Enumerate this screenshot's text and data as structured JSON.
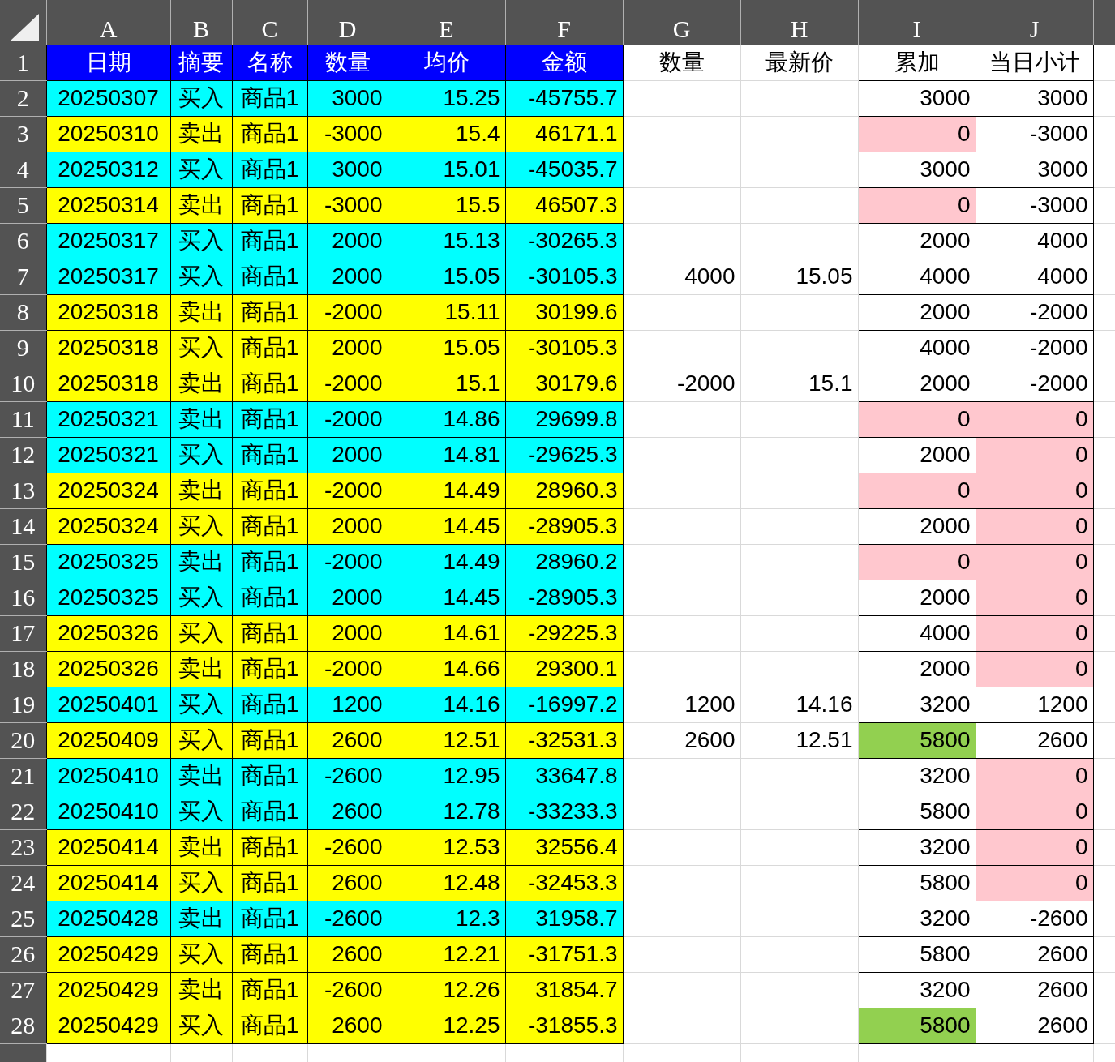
{
  "columns": [
    "A",
    "B",
    "C",
    "D",
    "E",
    "F",
    "G",
    "H",
    "I",
    "J"
  ],
  "header_row": {
    "row": "1",
    "cells": [
      {
        "text": "日期",
        "color": "#0000ff"
      },
      {
        "text": "摘要",
        "color": "#0000ff"
      },
      {
        "text": "名称",
        "color": "#0000ff"
      },
      {
        "text": "数量",
        "color": "#0000ff"
      },
      {
        "text": "均价",
        "color": "#0000ff"
      },
      {
        "text": "金额",
        "color": "#0000ff"
      },
      {
        "text": "数量"
      },
      {
        "text": "最新价"
      },
      {
        "text": "累加"
      },
      {
        "text": "当日小计"
      }
    ]
  },
  "rows": [
    {
      "row": "2",
      "color": "#00ffff",
      "cells": [
        "20250307",
        "买入",
        "商品1",
        "3000",
        "15.25",
        "-45755.7"
      ],
      "cumulative": {
        "text": "3000"
      },
      "daily_subtotal": {
        "text": "3000"
      }
    },
    {
      "row": "3",
      "color": "#ffff00",
      "cells": [
        "20250310",
        "卖出",
        "商品1",
        "-3000",
        "15.4",
        "46171.1"
      ],
      "cumulative": {
        "text": "0",
        "color": "#ffc7ce"
      },
      "daily_subtotal": {
        "text": "-3000"
      }
    },
    {
      "row": "4",
      "color": "#00ffff",
      "cells": [
        "20250312",
        "买入",
        "商品1",
        "3000",
        "15.01",
        "-45035.7"
      ],
      "cumulative": {
        "text": "3000"
      },
      "daily_subtotal": {
        "text": "3000"
      }
    },
    {
      "row": "5",
      "color": "#ffff00",
      "cells": [
        "20250314",
        "卖出",
        "商品1",
        "-3000",
        "15.5",
        "46507.3"
      ],
      "cumulative": {
        "text": "0",
        "color": "#ffc7ce"
      },
      "daily_subtotal": {
        "text": "-3000"
      }
    },
    {
      "row": "6",
      "color": "#00ffff",
      "cells": [
        "20250317",
        "买入",
        "商品1",
        "2000",
        "15.13",
        "-30265.3"
      ],
      "cumulative": {
        "text": "2000"
      },
      "daily_subtotal": {
        "text": "4000"
      }
    },
    {
      "row": "7",
      "color": "#00ffff",
      "cells": [
        "20250317",
        "买入",
        "商品1",
        "2000",
        "15.05",
        "-30105.3"
      ],
      "latest_qty": "4000",
      "latest_price": "15.05",
      "cumulative": {
        "text": "4000"
      },
      "daily_subtotal": {
        "text": "4000"
      }
    },
    {
      "row": "8",
      "color": "#ffff00",
      "cells": [
        "20250318",
        "卖出",
        "商品1",
        "-2000",
        "15.11",
        "30199.6"
      ],
      "cumulative": {
        "text": "2000"
      },
      "daily_subtotal": {
        "text": "-2000"
      }
    },
    {
      "row": "9",
      "color": "#ffff00",
      "cells": [
        "20250318",
        "买入",
        "商品1",
        "2000",
        "15.05",
        "-30105.3"
      ],
      "cumulative": {
        "text": "4000"
      },
      "daily_subtotal": {
        "text": "-2000"
      }
    },
    {
      "row": "10",
      "color": "#ffff00",
      "cells": [
        "20250318",
        "卖出",
        "商品1",
        "-2000",
        "15.1",
        "30179.6"
      ],
      "latest_qty": "-2000",
      "latest_price": "15.1",
      "cumulative": {
        "text": "2000"
      },
      "daily_subtotal": {
        "text": "-2000"
      }
    },
    {
      "row": "11",
      "color": "#00ffff",
      "cells": [
        "20250321",
        "卖出",
        "商品1",
        "-2000",
        "14.86",
        "29699.8"
      ],
      "cumulative": {
        "text": "0",
        "color": "#ffc7ce"
      },
      "daily_subtotal": {
        "text": "0",
        "color": "#ffc7ce"
      }
    },
    {
      "row": "12",
      "color": "#00ffff",
      "cells": [
        "20250321",
        "买入",
        "商品1",
        "2000",
        "14.81",
        "-29625.3"
      ],
      "cumulative": {
        "text": "2000"
      },
      "daily_subtotal": {
        "text": "0",
        "color": "#ffc7ce"
      }
    },
    {
      "row": "13",
      "color": "#ffff00",
      "cells": [
        "20250324",
        "卖出",
        "商品1",
        "-2000",
        "14.49",
        "28960.3"
      ],
      "cumulative": {
        "text": "0",
        "color": "#ffc7ce"
      },
      "daily_subtotal": {
        "text": "0",
        "color": "#ffc7ce"
      }
    },
    {
      "row": "14",
      "color": "#ffff00",
      "cells": [
        "20250324",
        "买入",
        "商品1",
        "2000",
        "14.45",
        "-28905.3"
      ],
      "cumulative": {
        "text": "2000"
      },
      "daily_subtotal": {
        "text": "0",
        "color": "#ffc7ce"
      }
    },
    {
      "row": "15",
      "color": "#00ffff",
      "cells": [
        "20250325",
        "卖出",
        "商品1",
        "-2000",
        "14.49",
        "28960.2"
      ],
      "cumulative": {
        "text": "0",
        "color": "#ffc7ce"
      },
      "daily_subtotal": {
        "text": "0",
        "color": "#ffc7ce"
      }
    },
    {
      "row": "16",
      "color": "#00ffff",
      "cells": [
        "20250325",
        "买入",
        "商品1",
        "2000",
        "14.45",
        "-28905.3"
      ],
      "cumulative": {
        "text": "2000"
      },
      "daily_subtotal": {
        "text": "0",
        "color": "#ffc7ce"
      }
    },
    {
      "row": "17",
      "color": "#ffff00",
      "cells": [
        "20250326",
        "买入",
        "商品1",
        "2000",
        "14.61",
        "-29225.3"
      ],
      "cumulative": {
        "text": "4000"
      },
      "daily_subtotal": {
        "text": "0",
        "color": "#ffc7ce"
      }
    },
    {
      "row": "18",
      "color": "#ffff00",
      "cells": [
        "20250326",
        "卖出",
        "商品1",
        "-2000",
        "14.66",
        "29300.1"
      ],
      "cumulative": {
        "text": "2000"
      },
      "daily_subtotal": {
        "text": "0",
        "color": "#ffc7ce"
      }
    },
    {
      "row": "19",
      "color": "#00ffff",
      "cells": [
        "20250401",
        "买入",
        "商品1",
        "1200",
        "14.16",
        "-16997.2"
      ],
      "latest_qty": "1200",
      "latest_price": "14.16",
      "cumulative": {
        "text": "3200"
      },
      "daily_subtotal": {
        "text": "1200"
      }
    },
    {
      "row": "20",
      "color": "#ffff00",
      "cells": [
        "20250409",
        "买入",
        "商品1",
        "2600",
        "12.51",
        "-32531.3"
      ],
      "latest_qty": "2600",
      "latest_price": "12.51",
      "cumulative": {
        "text": "5800",
        "color": "#92d050"
      },
      "daily_subtotal": {
        "text": "2600"
      }
    },
    {
      "row": "21",
      "color": "#00ffff",
      "cells": [
        "20250410",
        "卖出",
        "商品1",
        "-2600",
        "12.95",
        "33647.8"
      ],
      "cumulative": {
        "text": "3200"
      },
      "daily_subtotal": {
        "text": "0",
        "color": "#ffc7ce"
      }
    },
    {
      "row": "22",
      "color": "#00ffff",
      "cells": [
        "20250410",
        "买入",
        "商品1",
        "2600",
        "12.78",
        "-33233.3"
      ],
      "cumulative": {
        "text": "5800"
      },
      "daily_subtotal": {
        "text": "0",
        "color": "#ffc7ce"
      }
    },
    {
      "row": "23",
      "color": "#ffff00",
      "cells": [
        "20250414",
        "卖出",
        "商品1",
        "-2600",
        "12.53",
        "32556.4"
      ],
      "cumulative": {
        "text": "3200"
      },
      "daily_subtotal": {
        "text": "0",
        "color": "#ffc7ce"
      }
    },
    {
      "row": "24",
      "color": "#ffff00",
      "cells": [
        "20250414",
        "买入",
        "商品1",
        "2600",
        "12.48",
        "-32453.3"
      ],
      "cumulative": {
        "text": "5800"
      },
      "daily_subtotal": {
        "text": "0",
        "color": "#ffc7ce"
      }
    },
    {
      "row": "25",
      "color": "#00ffff",
      "cells": [
        "20250428",
        "卖出",
        "商品1",
        "-2600",
        "12.3",
        "31958.7"
      ],
      "cumulative": {
        "text": "3200"
      },
      "daily_subtotal": {
        "text": "-2600"
      }
    },
    {
      "row": "26",
      "color": "#ffff00",
      "cells": [
        "20250429",
        "买入",
        "商品1",
        "2600",
        "12.21",
        "-31751.3"
      ],
      "cumulative": {
        "text": "5800"
      },
      "daily_subtotal": {
        "text": "2600"
      }
    },
    {
      "row": "27",
      "color": "#ffff00",
      "cells": [
        "20250429",
        "卖出",
        "商品1",
        "-2600",
        "12.26",
        "31854.7"
      ],
      "cumulative": {
        "text": "3200"
      },
      "daily_subtotal": {
        "text": "2600"
      }
    },
    {
      "row": "28",
      "color": "#ffff00",
      "cells": [
        "20250429",
        "买入",
        "商品1",
        "2600",
        "12.25",
        "-31855.3"
      ],
      "cumulative": {
        "text": "5800",
        "color": "#92d050"
      },
      "daily_subtotal": {
        "text": "2600"
      }
    }
  ]
}
